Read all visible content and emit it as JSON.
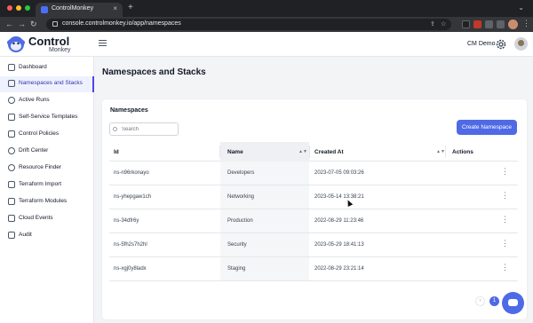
{
  "browser": {
    "tab_title": "ControlMonkey",
    "tab_close": "×",
    "new_tab": "+",
    "url": "console.controlmonkey.io/app/namespaces",
    "back": "←",
    "forward": "→",
    "reload": "↻"
  },
  "header": {
    "brand_top": "Control",
    "brand_bottom": "Monkey",
    "user_name": "CM Demo"
  },
  "sidebar": {
    "items": [
      {
        "label": "Dashboard",
        "icon": "dashboard-icon"
      },
      {
        "label": "Namespaces and Stacks",
        "icon": "grid-icon",
        "active": true
      },
      {
        "label": "Active Runs",
        "icon": "refresh-icon"
      },
      {
        "label": "Self-Service Templates",
        "icon": "template-icon"
      },
      {
        "label": "Control Policies",
        "icon": "policy-icon"
      },
      {
        "label": "Drift Center",
        "icon": "drift-icon"
      },
      {
        "label": "Resource Finder",
        "icon": "search-icon"
      },
      {
        "label": "Terraform Import",
        "icon": "import-icon"
      },
      {
        "label": "Terraform Modules",
        "icon": "module-icon"
      },
      {
        "label": "Cloud Events",
        "icon": "cloud-icon"
      },
      {
        "label": "Audit",
        "icon": "audit-icon"
      }
    ]
  },
  "main": {
    "page_title": "Namespaces and Stacks",
    "card_title": "Namespaces",
    "search_placeholder": "Search",
    "create_button": "Create Namespace",
    "columns": {
      "id": "Id",
      "name": "Name",
      "created_at": "Created At",
      "actions": "Actions"
    },
    "rows": [
      {
        "id": "ns-n96rkonayo",
        "name": "Developers",
        "created_at": "2023-07-05 09:03:26"
      },
      {
        "id": "ns-yhepgaw1ch",
        "name": "Networking",
        "created_at": "2023-05-14 13:38:21"
      },
      {
        "id": "ns-34dfr6y",
        "name": "Production",
        "created_at": "2022-08-29 11:23:46"
      },
      {
        "id": "ns-5fh2s7h2hl",
        "name": "Security",
        "created_at": "2023-05-29 18:41:13"
      },
      {
        "id": "ns-xgj0y8ladx",
        "name": "Staging",
        "created_at": "2022-08-29 23:21:14"
      }
    ],
    "pagination": {
      "prev": "‹",
      "current_page": "1"
    }
  },
  "colors": {
    "accent": "#4f6ae6",
    "active_bg": "#eef2ff"
  }
}
